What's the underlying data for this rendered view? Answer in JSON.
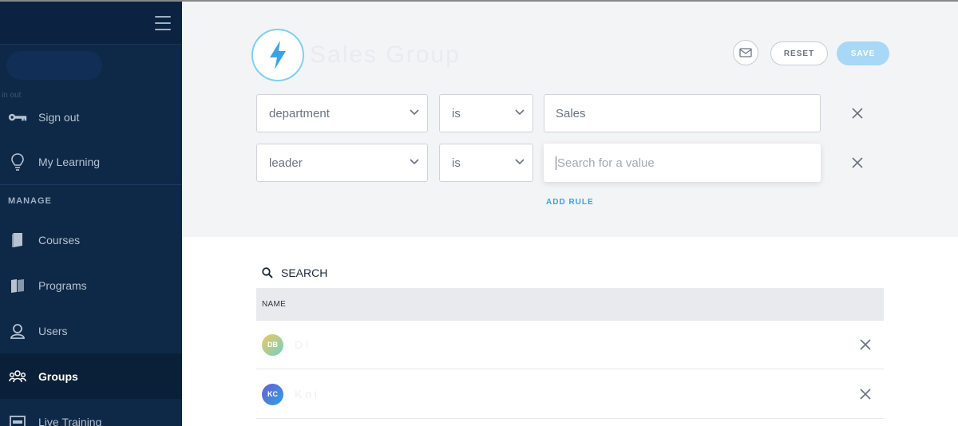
{
  "sidebar": {
    "profile_faded_text": "in out",
    "items_top": [
      {
        "label": "Sign out",
        "icon": "key-icon"
      },
      {
        "label": "My Learning",
        "icon": "lightbulb-icon"
      }
    ],
    "section_label": "MANAGE",
    "items_manage": [
      {
        "label": "Courses",
        "icon": "book-icon"
      },
      {
        "label": "Programs",
        "icon": "books-icon"
      },
      {
        "label": "Users",
        "icon": "user-icon"
      },
      {
        "label": "Groups",
        "icon": "groups-icon",
        "active": true
      },
      {
        "label": "Live Training",
        "icon": "calendar-icon"
      }
    ]
  },
  "header": {
    "group_name_faded": "Sales Group",
    "reset_label": "RESET",
    "save_label": "SAVE"
  },
  "rules": [
    {
      "field": "department",
      "operator": "is",
      "value": "Sales",
      "placeholder": ""
    },
    {
      "field": "leader",
      "operator": "is",
      "value": "",
      "placeholder": "Search for a value"
    }
  ],
  "add_rule_label": "ADD RULE",
  "members": {
    "search_label": "SEARCH",
    "column_name": "NAME",
    "rows": [
      {
        "initials": "DB",
        "name_faded": "D     l"
      },
      {
        "initials": "KC",
        "name_faded": "K  n       i"
      }
    ]
  },
  "colors": {
    "sidebar_bg": "#0e2847",
    "accent": "#3aa3e3",
    "save_disabled": "#a7d8f5",
    "bolt": "#3aa3e3"
  }
}
